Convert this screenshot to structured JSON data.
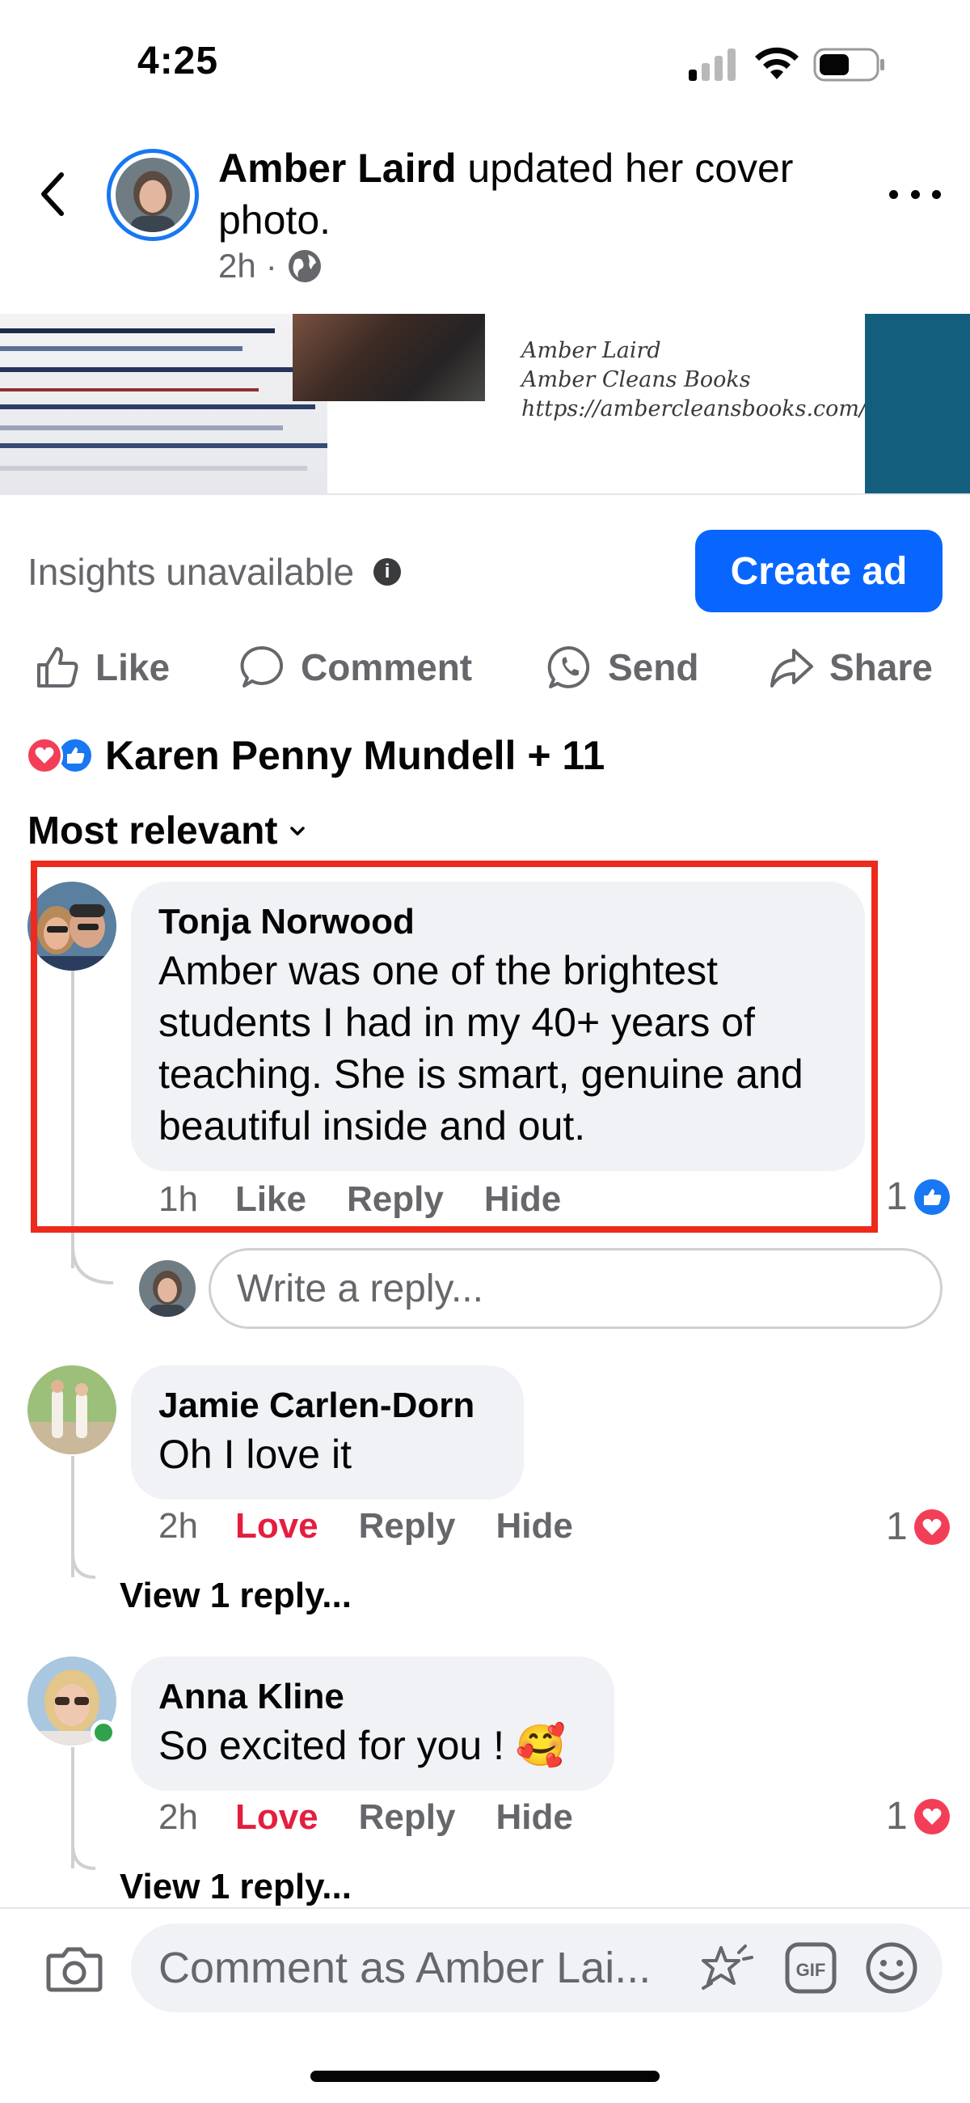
{
  "status_bar": {
    "time": "4:25"
  },
  "header": {
    "author": "Amber Laird",
    "action": " updated her cover photo.",
    "time": "2h",
    "separator": "·"
  },
  "cover": {
    "lines": [
      "Amber Laird",
      "Amber Cleans Books",
      "https://ambercleansbooks.com/"
    ]
  },
  "insights": {
    "label": "Insights unavailable",
    "info": "i",
    "create_ad": "Create ad"
  },
  "actions": {
    "like": "Like",
    "comment": "Comment",
    "send": "Send",
    "share": "Share"
  },
  "reactions": {
    "summary": "Karen Penny Mundell + 11"
  },
  "sort": {
    "label": "Most relevant"
  },
  "comments": [
    {
      "name": "Tonja Norwood",
      "text": "Amber was one of the brightest students I had in my 40+ years of teaching. She is smart, genuine and beautiful inside and out.",
      "time": "1h",
      "reaction": "Like",
      "reply": "Reply",
      "hide": "Hide",
      "react_count": "1",
      "react_type": "like"
    },
    {
      "name": "Jamie Carlen-Dorn",
      "text": "Oh I love it",
      "time": "2h",
      "reaction": "Love",
      "reply": "Reply",
      "hide": "Hide",
      "react_count": "1",
      "react_type": "love",
      "view_replies": "View 1 reply..."
    },
    {
      "name": "Anna Kline",
      "text": "So excited for you ! 🥰",
      "time": "2h",
      "reaction": "Love",
      "reply": "Reply",
      "hide": "Hide",
      "react_count": "1",
      "react_type": "love",
      "view_replies": "View 1 reply..."
    }
  ],
  "reply_input": {
    "placeholder": "Write a reply..."
  },
  "composer": {
    "placeholder": "Comment as Amber Lai..."
  },
  "colors": {
    "accent": "#0866ff",
    "love": "#e41e3f",
    "highlight": "#ee2a1d",
    "bubble": "#f0f2f5"
  }
}
